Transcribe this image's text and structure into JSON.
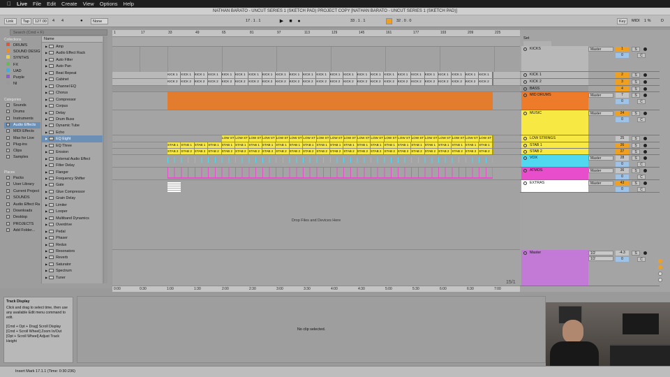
{
  "menubar": {
    "apple": "",
    "app": "Live",
    "items": [
      "File",
      "Edit",
      "Create",
      "View",
      "Options",
      "Help"
    ]
  },
  "title": "NATHAN BARATO - UNCUT SERIES 1 (SKETCH PAD) PROJECT COPY  [NATHAN BARATO - UNCUT SERIES 1 (SKETCH PAD)]",
  "transport": {
    "link": "Link",
    "tap": "Tap",
    "tempo": "127.00",
    "sig_num": "4",
    "sig_den": "4",
    "quantize": "None",
    "position": "17 .   1 .   1",
    "position2": "33 .   1 .   1",
    "loop_len": "32 .   0 .   0",
    "key": "Key",
    "midi": "MIDI",
    "cpu": "1 %",
    "d": "D"
  },
  "browser": {
    "search_placeholder": "Search (Cmd + F)",
    "collections_label": "Collections",
    "collections": [
      {
        "label": "DRUMS",
        "color": "#e0563c"
      },
      {
        "label": "SOUND DESIGN",
        "color": "#ee8a2e"
      },
      {
        "label": "SYNTHS",
        "color": "#e8d33c"
      },
      {
        "label": "FX",
        "color": "#5fbf4a"
      },
      {
        "label": "UAD",
        "color": "#3cb0e0"
      },
      {
        "label": "Purple",
        "color": "#8b5ad6"
      },
      {
        "label": "NI",
        "color": "#9a9a9a"
      }
    ],
    "categories_label": "Categories",
    "categories": [
      "Sounds",
      "Drums",
      "Instruments",
      "Audio Effects",
      "MIDI Effects",
      "Max for Live",
      "Plug-ins",
      "Clips",
      "Samples"
    ],
    "places_label": "Places",
    "places": [
      "Packs",
      "User Library",
      "Current Project",
      "SOUNDS",
      "Audio Effect Ra",
      "Downloads",
      "Desktop",
      "PROJECTS",
      "Add Folder..."
    ],
    "name_header": "Name",
    "items": [
      "Amp",
      "Audio Effect Rack",
      "Auto Filter",
      "Auto Pan",
      "Beat Repeat",
      "Cabinet",
      "Channel EQ",
      "Chorus",
      "Compressor",
      "Corpus",
      "Delay",
      "Drum Buss",
      "Dynamic Tube",
      "Echo",
      "EQ Eight",
      "EQ Three",
      "Erosion",
      "External Audio Effect",
      "Filter Delay",
      "Flanger",
      "Frequency Shifter",
      "Gate",
      "Glue Compressor",
      "Grain Delay",
      "Limiter",
      "Looper",
      "Multiband Dynamics",
      "Overdrive",
      "Pedal",
      "Phaser",
      "Redux",
      "Resonators",
      "Reverb",
      "Saturator",
      "Spectrum",
      "Tuner"
    ]
  },
  "ruler": [
    "1",
    "17",
    "33",
    "49",
    "65",
    "81",
    "97",
    "113",
    "129",
    "145",
    "161",
    "177",
    "193",
    "209",
    "225"
  ],
  "timeline": [
    "0:00",
    "0:30",
    "1:00",
    "1:30",
    "2:00",
    "2:30",
    "3:00",
    "3:30",
    "4:00",
    "4:30",
    "5:00",
    "5:30",
    "6:00",
    "6:30",
    "7:00"
  ],
  "clips": {
    "kick1": "KICK 1",
    "kick2": "KICK 2",
    "low": "LOW ST",
    "stab1": "STAB 1",
    "stab2": "STAB 2"
  },
  "drop_text": "Drop Files and Devices Here",
  "page_indicator": "15/1",
  "mixer": {
    "set_label": "Set",
    "tracks": [
      {
        "name": "KICKS",
        "routing": "Master",
        "num": "1",
        "num2": "0",
        "color": "#b8b8b8"
      },
      {
        "name": "KICK 1",
        "num": "2",
        "color": "#b8b8b8"
      },
      {
        "name": "KICK 2",
        "num": "3",
        "color": "#b8b8b8"
      },
      {
        "name": "BASS",
        "num": "4",
        "color": "#9a9a9a"
      },
      {
        "name": "MID DRUMS",
        "routing": "Master",
        "num": "7",
        "num2": "0",
        "color": "#ee7b2a"
      },
      {
        "name": "MUSIC",
        "routing": "Master",
        "num": "24",
        "num2": "0",
        "color": "#f7e843"
      },
      {
        "name": "LOW STRINGS",
        "num": "25",
        "color": "#f7e843"
      },
      {
        "name": "STAB 1",
        "num": "26",
        "color": "#f7e843"
      },
      {
        "name": "STAB 2",
        "num": "27",
        "color": "#f7e843"
      },
      {
        "name": "VOX",
        "routing": "Master",
        "num": "28",
        "num2": "0",
        "color": "#4fd8f0"
      },
      {
        "name": "ATMOS",
        "routing": "Master",
        "num": "36",
        "num2": "0",
        "color": "#e84dcc"
      },
      {
        "name": "EXTRAS",
        "routing": "Master",
        "num": "43",
        "num2": "0",
        "color": "#ffffff"
      },
      {
        "name": "Master",
        "routing": "1/2",
        "routing2": "1/2",
        "num": "-4.3",
        "num2": "0",
        "color": "#c27ad6"
      }
    ],
    "s_label": "S",
    "c_label": "C"
  },
  "info": {
    "title": "Track Display",
    "text": "Click and drag to select time, then use any available Edit menu command to edit.",
    "hints": [
      "[Cmd + Opt + Drag] Scroll Display",
      "[Cmd + Scroll Wheel] Zoom In/Out",
      "[Opt + Scroll Wheel] Adjust Track Height"
    ]
  },
  "detail_text": "No clip selected.",
  "status": "Insert Mark 17.1.1 (Time: 0:30:236)"
}
